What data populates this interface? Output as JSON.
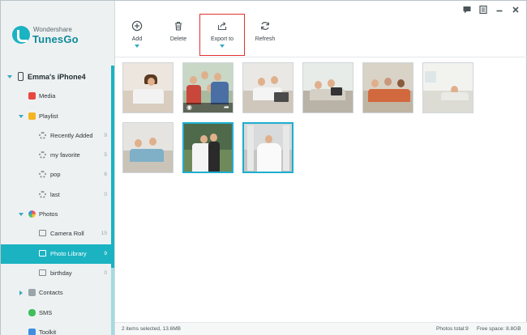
{
  "app": {
    "brand_small": "Wondershare",
    "brand_name": "TunesGo",
    "accent_color": "#1bb3c2",
    "highlight_color": "#e0312f"
  },
  "window_controls": [
    {
      "name": "feedback-icon"
    },
    {
      "name": "menu-icon"
    },
    {
      "name": "minimize-icon"
    },
    {
      "name": "close-icon"
    }
  ],
  "toolbar": {
    "add_label": "Add",
    "delete_label": "Delete",
    "export_label": "Export to",
    "refresh_label": "Refresh"
  },
  "sidebar": {
    "device": "Emma's iPhone4",
    "media": "Media",
    "playlist": "Playlist",
    "playlists": [
      {
        "label": "Recently Added",
        "count": "9"
      },
      {
        "label": "my favorite",
        "count": "5"
      },
      {
        "label": "pop",
        "count": "6"
      },
      {
        "label": "last",
        "count": "0"
      }
    ],
    "photos": "Photos",
    "albums": [
      {
        "label": "Camera Roll",
        "count": "15"
      },
      {
        "label": "Photo Library",
        "count": "9"
      },
      {
        "label": "birthday",
        "count": "0"
      }
    ],
    "contacts": "Contacts",
    "sms": "SMS",
    "toolkit": "Toolkit"
  },
  "photos": [
    {
      "selected": false
    },
    {
      "selected": false
    },
    {
      "selected": false
    },
    {
      "selected": false
    },
    {
      "selected": false
    },
    {
      "selected": false
    },
    {
      "selected": false
    },
    {
      "selected": true
    },
    {
      "selected": true
    }
  ],
  "status": {
    "selection": "2 items selected, 13.6MB",
    "photos_total": "Photos total:9",
    "free_space": "Free space: 8.8GB"
  }
}
